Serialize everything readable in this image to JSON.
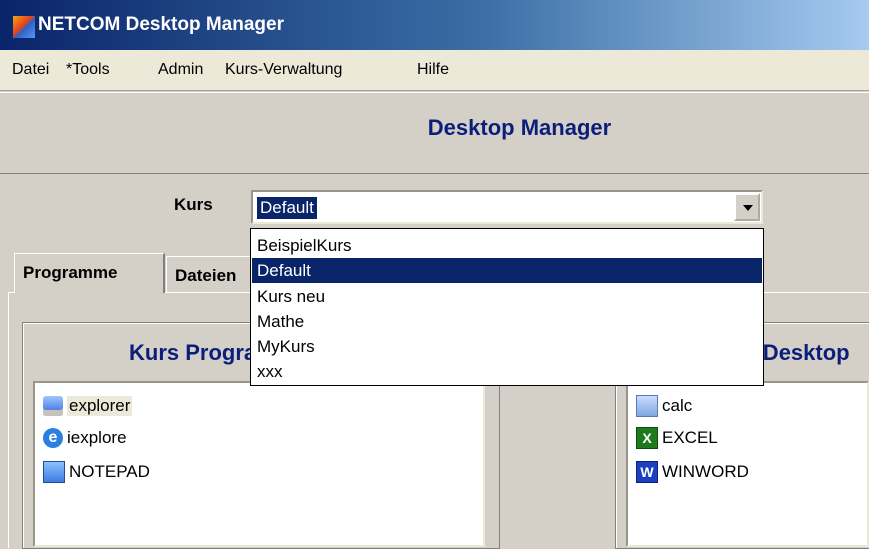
{
  "window": {
    "title": "NETCOM Desktop Manager"
  },
  "menu": {
    "items": [
      {
        "label": "Datei"
      },
      {
        "label": "*Tools"
      },
      {
        "label": "Admin"
      },
      {
        "label": "Kurs-Verwaltung"
      },
      {
        "label": "Hilfe"
      }
    ]
  },
  "header": {
    "title": "Desktop Manager"
  },
  "kurs": {
    "label": "Kurs",
    "selected": "Default",
    "options": [
      "BeispielKurs",
      "Default",
      "Kurs neu",
      "Mathe",
      "MyKurs",
      "xxx"
    ]
  },
  "tabs": [
    {
      "label": "Programme",
      "active": true
    },
    {
      "label": "Dateien",
      "active": false
    }
  ],
  "left_group": {
    "title": "Kurs Programme",
    "items": [
      {
        "label": "explorer",
        "icon": "explorer-icon"
      },
      {
        "label": "iexplore",
        "icon": "iexplore-icon"
      },
      {
        "label": "NOTEPAD",
        "icon": "notepad-icon"
      }
    ]
  },
  "right_group": {
    "title": "Schüler Desktop",
    "items": [
      {
        "label": "calc",
        "icon": "calc-icon"
      },
      {
        "label": "EXCEL",
        "icon": "excel-icon"
      },
      {
        "label": "WINWORD",
        "icon": "word-icon"
      }
    ]
  }
}
